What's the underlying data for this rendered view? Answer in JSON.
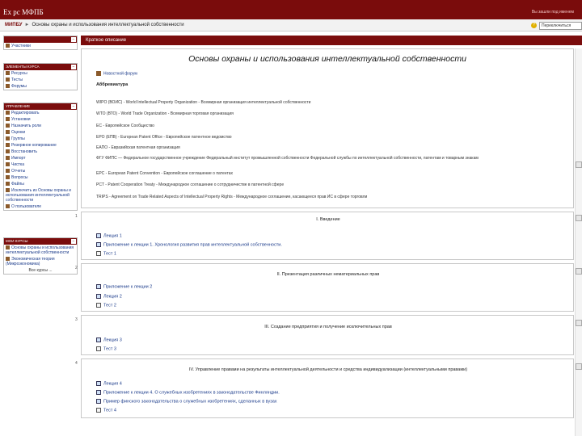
{
  "header": {
    "site_title": "Ех рс МФПБ",
    "login_info": "Вы зашли под именем"
  },
  "nav": {
    "home": "МИПБУ",
    "sep": "►",
    "course": "Основы охраны и использования интеллектуальной собственности",
    "help": "?",
    "role_button": "Переключиться"
  },
  "sidebar": {
    "people": {
      "title": "",
      "items": [
        {
          "label": "Участники"
        }
      ]
    },
    "elements": {
      "title": "ЭЛЕМЕНТЫ КУРСА",
      "items": [
        {
          "label": "Ресурсы"
        },
        {
          "label": "Тесты"
        },
        {
          "label": "Форумы"
        }
      ]
    },
    "admin": {
      "title": "УПРАВЛЕНИЕ",
      "items": [
        {
          "label": "Редактировать"
        },
        {
          "label": "Установки"
        },
        {
          "label": "Назначить роли"
        },
        {
          "label": "Оценки"
        },
        {
          "label": "Группы"
        },
        {
          "label": "Резервное копирование"
        },
        {
          "label": "Восстановить"
        },
        {
          "label": "Импорт"
        },
        {
          "label": "Чистка"
        },
        {
          "label": "Отчеты"
        },
        {
          "label": "Вопросы"
        },
        {
          "label": "Файлы"
        },
        {
          "label": "Исключить из Основы охраны и использования интеллектуальной собственности"
        },
        {
          "label": "О пользователе"
        }
      ]
    },
    "mycourses": {
      "title": "МОИ КУРСЫ",
      "items": [
        {
          "label": "Основы охраны и использования интеллектуальной собственности"
        },
        {
          "label": "Экономическая теория (Микроэкономика)"
        }
      ],
      "all": "Все курсы ..."
    }
  },
  "main": {
    "head": "Краткое описание",
    "title": "Основы охраны и использования интеллектуальной собственности",
    "forum": "Новостной форум",
    "abbr_title": "Аббревиатура",
    "abbreviations": [
      "WIPO (ВОИС) - World Intellectual Property Organization - Всемирная организация интеллектуальной собственности",
      "WTO (ВТО) - World Trade Organization - Всемирная торговая организация",
      "EC - Европейское Сообщество",
      "EPO (ЕПВ) - European Patent Office - Европейское патентное ведомство",
      "ЕАПО - Евразийская патентная организация",
      "ФГУ ФИПС — Федеральное государственное учреждение Федеральный институт промышленной собственности Федеральной службы по интеллектуальной собственности, патентам и товарным знакам",
      "EPC - European Patent Convention - Европейское соглашение о патентах",
      "PCT - Patent Cooperation Treaty - Международное соглашение о сотрудничестве в патентной сфере",
      "TRIPS - Agreement on Trade Related Aspects of Intellectual Property Rights - Международное соглашение, касающееся прав ИС в сфере торговли"
    ],
    "sections": [
      {
        "num": "1",
        "title": "I. Введение",
        "items": [
          {
            "label": "Лекция 1",
            "type": "doc"
          },
          {
            "label": "Приложение к лекции 1. Хронология развития прав интеллектуальной собственности.",
            "type": "doc"
          },
          {
            "label": "Тест 1",
            "type": "quiz"
          }
        ]
      },
      {
        "num": "2",
        "title": "II. Презентация различных нематериальных прав",
        "items": [
          {
            "label": "Приложение к лекции 2",
            "type": "doc"
          },
          {
            "label": "Лекция 2",
            "type": "doc"
          },
          {
            "label": "Тест 2",
            "type": "quiz"
          }
        ]
      },
      {
        "num": "3",
        "title": "III. Создание предприятия и получение исключительных прав",
        "items": [
          {
            "label": "Лекция 3",
            "type": "doc"
          },
          {
            "label": "Тест 3",
            "type": "quiz"
          }
        ]
      },
      {
        "num": "4",
        "title": "IV. Управление правами на результаты интеллектуальной деятельности и средства индивидуализации (интеллектуальными правами)",
        "items": [
          {
            "label": "Лекция 4",
            "type": "doc"
          },
          {
            "label": "Приложение к лекции 4. О служебных изобретениях в законодательстве Финляндии.",
            "type": "doc"
          },
          {
            "label": "Пример финского законодательства о служебных изобретениях, сделанных в вузах",
            "type": "doc"
          },
          {
            "label": "Тест 4",
            "type": "quiz"
          }
        ]
      }
    ]
  }
}
